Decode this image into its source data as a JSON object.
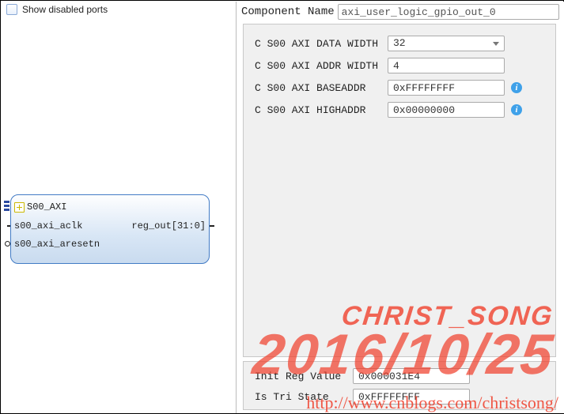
{
  "left": {
    "show_disabled_label": "Show disabled ports",
    "show_disabled_checked": false,
    "block": {
      "bus_port": "S00_AXI",
      "clk_port": "s00_axi_aclk",
      "rstn_port": "s00_axi_aresetn",
      "out_port": "reg_out[31:0]"
    }
  },
  "right": {
    "component_name_label": "Component Name",
    "component_name": "axi_user_logic_gpio_out_0",
    "params": [
      {
        "label": "C S00 AXI DATA WIDTH",
        "value": "32",
        "kind": "select"
      },
      {
        "label": "C S00 AXI ADDR WIDTH",
        "value": "4",
        "kind": "text"
      },
      {
        "label": "C S00 AXI BASEADDR",
        "value": "0xFFFFFFFF",
        "kind": "text_info"
      },
      {
        "label": "C S00 AXI HIGHADDR",
        "value": "0x00000000",
        "kind": "text_info"
      }
    ],
    "extra": [
      {
        "label": "Init Reg Value",
        "value": "0x000031E4"
      },
      {
        "label": "Is Tri State",
        "value": "0xFFFFFFFF"
      }
    ]
  },
  "watermark": {
    "line1": "CHRIST_SONG",
    "line2": "2016/10/25",
    "url": "http://www.cnblogs.com/christsong/"
  }
}
